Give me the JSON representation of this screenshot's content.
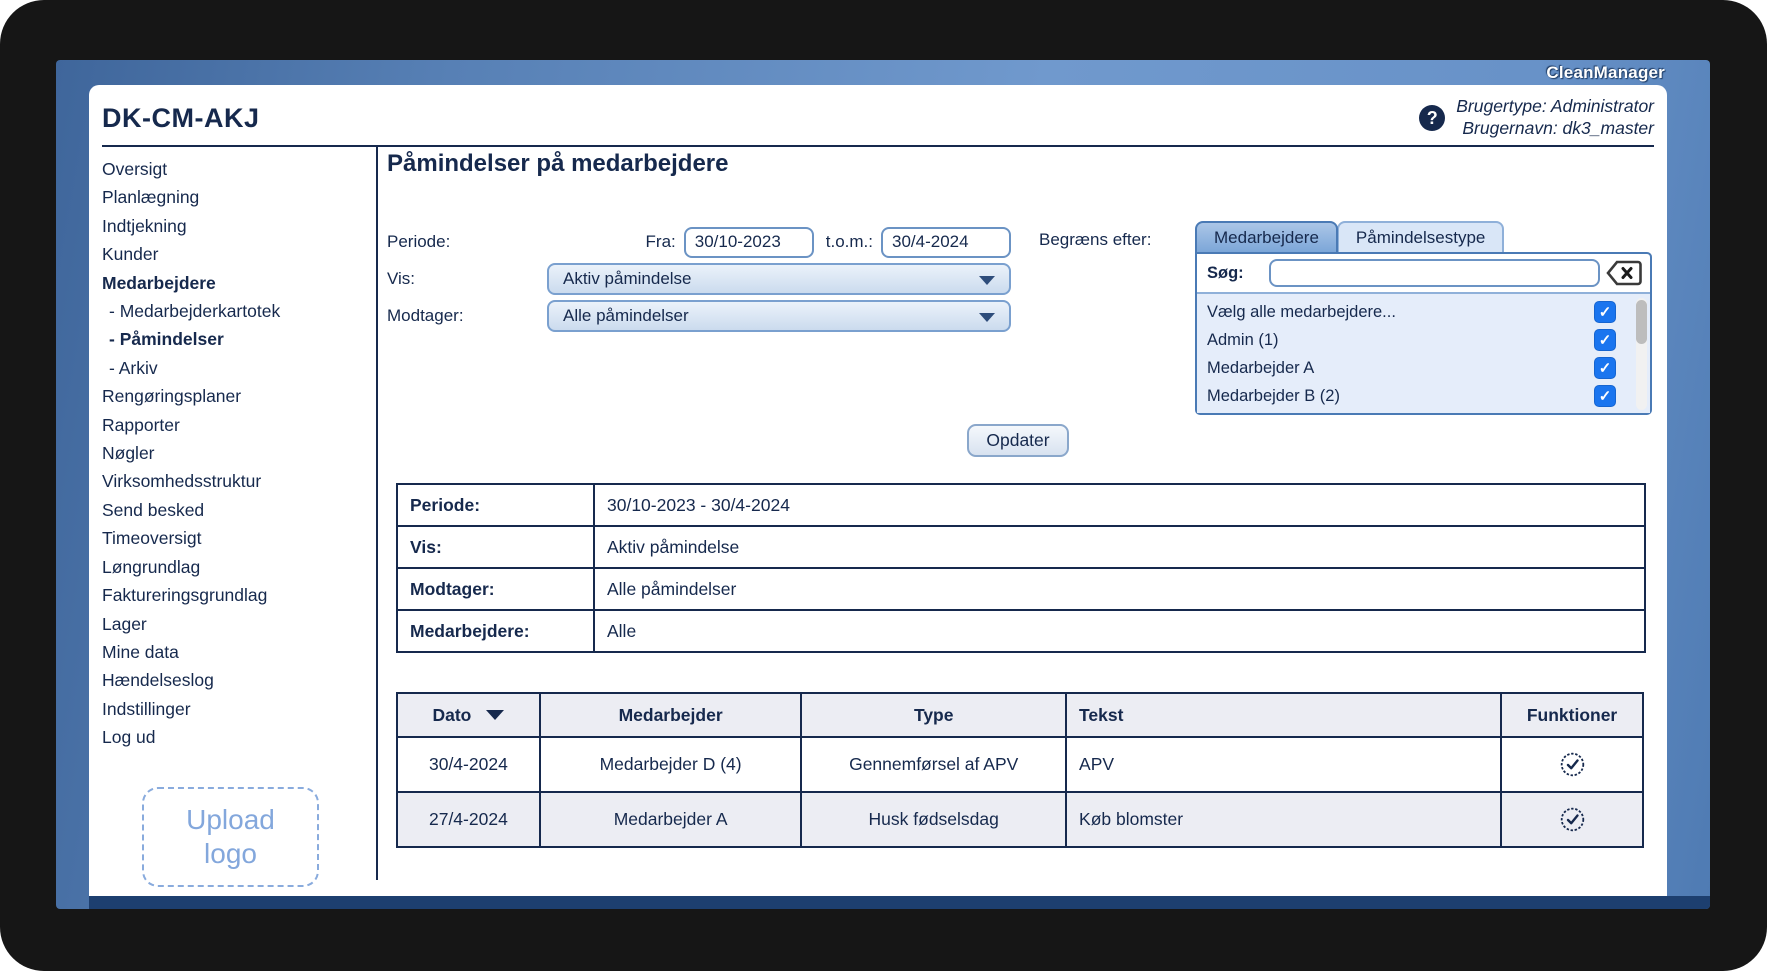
{
  "brand": "CleanManager",
  "header": {
    "title": "DK-CM-AKJ",
    "user_type_line": "Brugertype: Administrator",
    "user_name_line": "Brugernavn: dk3_master"
  },
  "icons": {
    "help_glyph": "?",
    "check_glyph": "✓"
  },
  "colors": {
    "accent_navy": "#16294d",
    "band_blue": "#6591c9",
    "panel_border": "#4a7ab5",
    "checkbox_blue": "#1a75ef",
    "list_bg": "#e5edfa",
    "table_alt_bg": "#ecedf3"
  },
  "sidebar": {
    "items": [
      "Oversigt",
      "Planlægning",
      "Indtjekning",
      "Kunder",
      "Medarbejdere",
      "- Medarbejderkartotek",
      "- Påmindelser",
      "- Arkiv",
      "Rengøringsplaner",
      "Rapporter",
      "Nøgler",
      "Virksomhedsstruktur",
      "Send besked",
      "Timeoversigt",
      "Løngrundlag",
      "Faktureringsgrundlag",
      "Lager",
      "Mine data",
      "Hændelseslog",
      "Indstillinger",
      "Log ud"
    ],
    "upload_logo": {
      "line1": "Upload",
      "line2": "logo"
    }
  },
  "main": {
    "title": "Påmindelser på medarbejdere",
    "form": {
      "periode_label": "Periode:",
      "fra_label": "Fra:",
      "fra_value": "30/10-2023",
      "tom_label": "t.o.m.:",
      "tom_value": "30/4-2024",
      "vis_label": "Vis:",
      "vis_value": "Aktiv påmindelse",
      "modtager_label": "Modtager:",
      "modtager_value": "Alle påmindelser",
      "begraens_label": "Begræns efter:",
      "tabs": [
        {
          "label": "Medarbejdere",
          "active": true
        },
        {
          "label": "Påmindelsestype",
          "active": false
        }
      ],
      "soeg_label": "Søg:",
      "soeg_value": "",
      "employee_list": [
        {
          "label": "Vælg alle medarbejdere...",
          "checked": true
        },
        {
          "label": "Admin (1)",
          "checked": true
        },
        {
          "label": "Medarbejder A",
          "checked": true
        },
        {
          "label": "Medarbejder B (2)",
          "checked": true
        }
      ],
      "submit_label": "Opdater"
    },
    "summary": {
      "rows": [
        {
          "label": "Periode:",
          "value": "30/10-2023 - 30/4-2024"
        },
        {
          "label": "Vis:",
          "value": "Aktiv påmindelse"
        },
        {
          "label": "Modtager:",
          "value": "Alle påmindelser"
        },
        {
          "label": "Medarbejdere:",
          "value": "Alle"
        }
      ]
    },
    "table": {
      "headers": [
        "Dato",
        "Medarbejder",
        "Type",
        "Tekst",
        "Funktioner"
      ],
      "sorted_by": "Dato",
      "sort_direction": "desc",
      "rows": [
        {
          "dato": "30/4-2024",
          "medarbejder": "Medarbejder D (4)",
          "type": "Gennemførsel af APV",
          "tekst": "APV"
        },
        {
          "dato": "27/4-2024",
          "medarbejder": "Medarbejder A",
          "type": "Husk fødselsdag",
          "tekst": "Køb blomster"
        }
      ]
    }
  }
}
